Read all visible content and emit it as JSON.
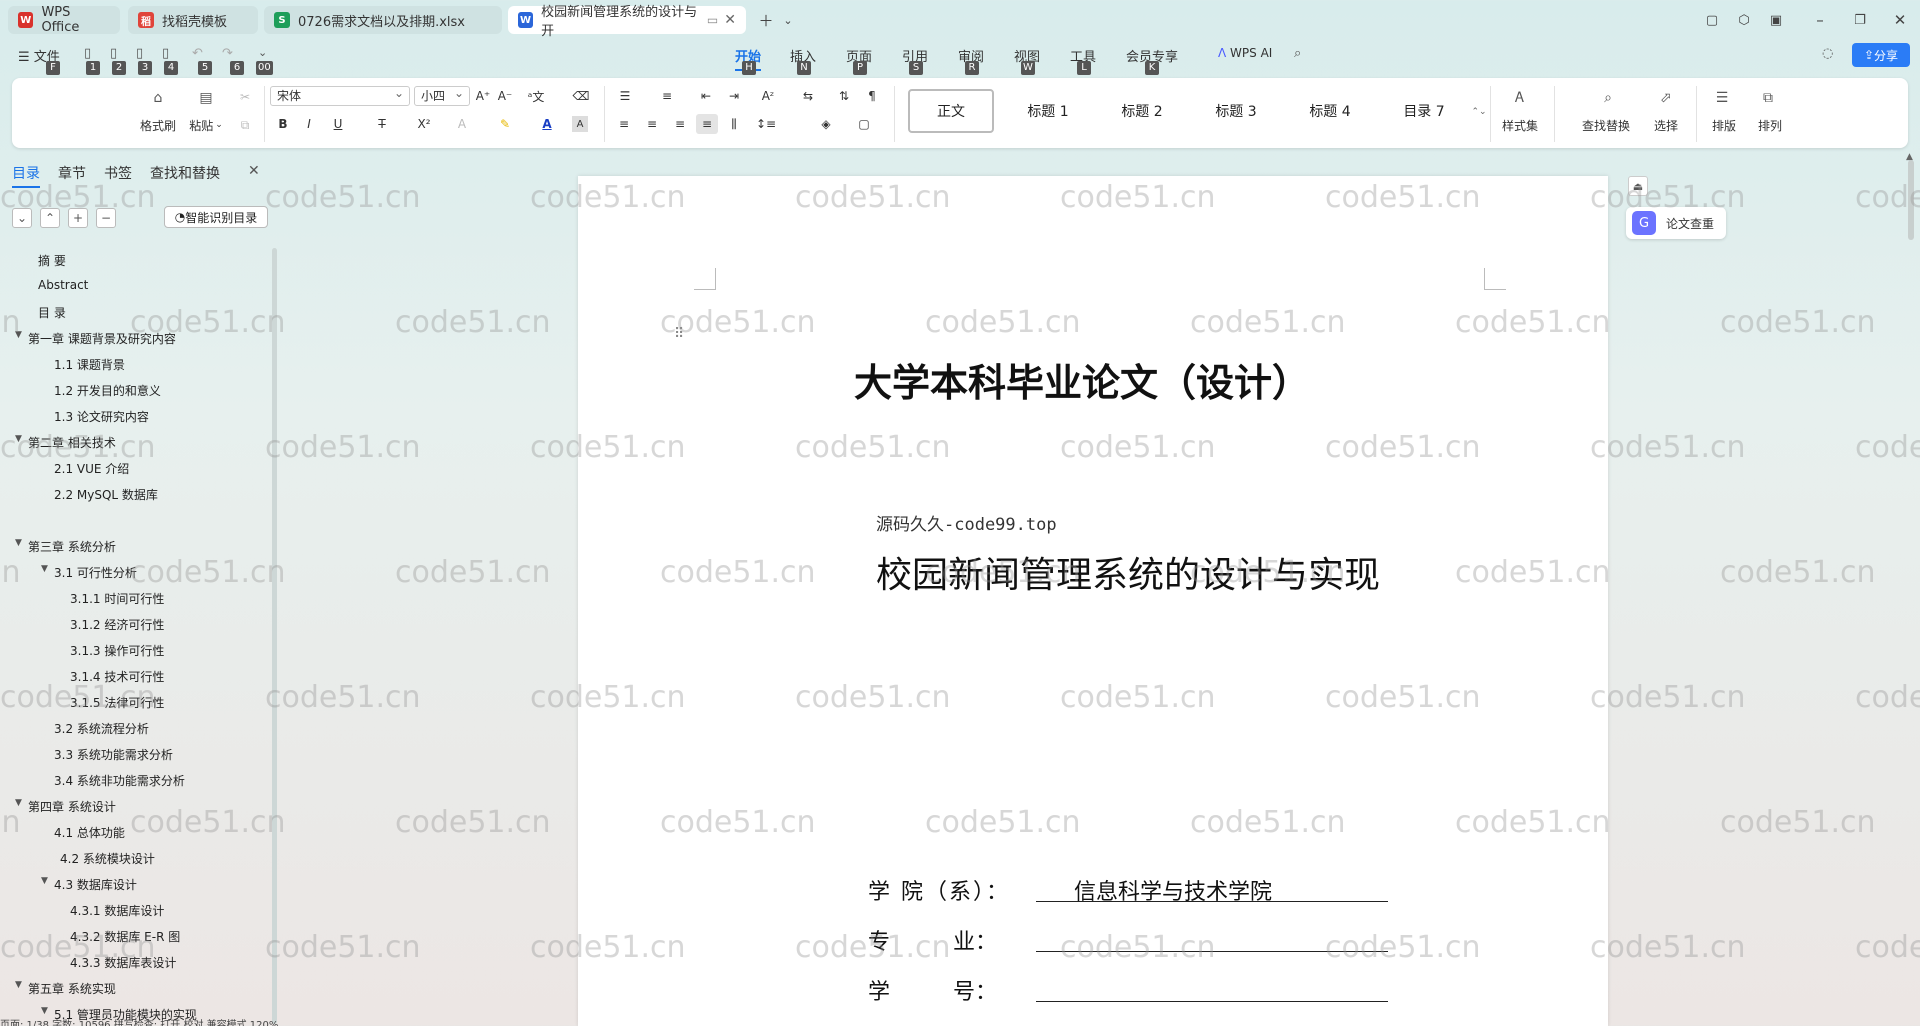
{
  "tabs": [
    {
      "label": "WPS Office",
      "icon": "W",
      "color": "#d9312b"
    },
    {
      "label": "找稻壳模板",
      "icon": "稻",
      "color": "#e0443a"
    },
    {
      "label": "0726需求文档以及排期.xlsx",
      "icon": "S",
      "color": "#1e9e5a"
    },
    {
      "label": "校园新闻管理系统的设计与开",
      "icon": "W",
      "color": "#2b66d9"
    }
  ],
  "menu": {
    "file": "文件",
    "items": [
      "开始",
      "插入",
      "页面",
      "引用",
      "审阅",
      "视图",
      "工具",
      "会员专享"
    ],
    "wps_ai": "WPS AI",
    "share": "分享",
    "keys": [
      "F",
      "1",
      "2",
      "3",
      "4",
      "5",
      "6",
      "00"
    ],
    "menu_keys": [
      "H",
      "N",
      "P",
      "S",
      "R",
      "W",
      "L",
      "K"
    ]
  },
  "ribbon": {
    "format_painter": "格式刷",
    "paste": "粘贴",
    "font": "宋体",
    "size": "小四",
    "styles": [
      "正文",
      "标题 1",
      "标题 2",
      "标题 3",
      "标题 4",
      "目录 7"
    ],
    "style_set": "样式集",
    "find_replace": "查找替换",
    "select": "选择",
    "layout": "排版",
    "arrange": "排列"
  },
  "nav": {
    "tabs": [
      "目录",
      "章节",
      "书签",
      "查找和替换"
    ],
    "smart_toc": "智能识别目录",
    "items": [
      {
        "label": "摘    要",
        "level": 1,
        "tri": false
      },
      {
        "label": "Abstract",
        "level": 1,
        "tri": false
      },
      {
        "label": "目    录",
        "level": 1,
        "tri": false
      },
      {
        "label": "第一章   课题背景及研究内容",
        "level": 0,
        "tri": true
      },
      {
        "label": "1.1  课题背景",
        "level": 2,
        "tri": false
      },
      {
        "label": "1.2  开发目的和意义",
        "level": 2,
        "tri": false
      },
      {
        "label": "1.3  论文研究内容",
        "level": 2,
        "tri": false
      },
      {
        "label": "第二章  相关技术",
        "level": 0,
        "tri": true
      },
      {
        "label": "2.1 VUE 介绍",
        "level": 2,
        "tri": false
      },
      {
        "label": "2.2 MySQL 数据库",
        "level": 2,
        "tri": false
      },
      {
        "label": "",
        "level": 2,
        "tri": false
      },
      {
        "label": "第三章  系统分析",
        "level": 0,
        "tri": true
      },
      {
        "label": "3.1 可行性分析",
        "level": 2,
        "tri": true
      },
      {
        "label": "3.1.1 时间可行性",
        "level": 3,
        "tri": false
      },
      {
        "label": "3.1.2  经济可行性",
        "level": 3,
        "tri": false
      },
      {
        "label": "3.1.3  操作可行性",
        "level": 3,
        "tri": false
      },
      {
        "label": "3.1.4  技术可行性",
        "level": 3,
        "tri": false
      },
      {
        "label": "3.1.5  法律可行性",
        "level": 3,
        "tri": false
      },
      {
        "label": "3.2 系统流程分析",
        "level": 2,
        "tri": false
      },
      {
        "label": "3.3 系统功能需求分析",
        "level": 2,
        "tri": false
      },
      {
        "label": "3.4  系统非功能需求分析",
        "level": 2,
        "tri": false
      },
      {
        "label": "第四章  系统设计",
        "level": 0,
        "tri": true
      },
      {
        "label": "4.1  总体功能",
        "level": 2,
        "tri": false
      },
      {
        "label": "4.2  系统模块设计",
        "level": 2,
        "tri": false,
        "indent": 6
      },
      {
        "label": "4.3  数据库设计",
        "level": 2,
        "tri": true
      },
      {
        "label": "4.3.1  数据库设计",
        "level": 3,
        "tri": false
      },
      {
        "label": "4.3.2  数据库 E-R 图",
        "level": 3,
        "tri": false
      },
      {
        "label": "4.3.3  数据库表设计",
        "level": 3,
        "tri": false
      },
      {
        "label": "第五章  系统实现",
        "level": 0,
        "tri": true
      },
      {
        "label": "5.1  管理员功能模块的实现",
        "level": 2,
        "tri": true
      }
    ]
  },
  "doc": {
    "title": "大学本科毕业论文（设计）",
    "source": "源码久久-code99.top",
    "subtitle": "校园新闻管理系统的设计与实现",
    "college_label": "学 院（系）：",
    "college_value": "信息科学与技术学院",
    "major_label": "专         业：",
    "id_label": "学         号："
  },
  "side": {
    "check": "论文查重"
  },
  "watermark": "code51.cn",
  "status": "页面: 1/38   字数: 10596   拼写检查: 打开   校对   兼容模式                                            120%"
}
